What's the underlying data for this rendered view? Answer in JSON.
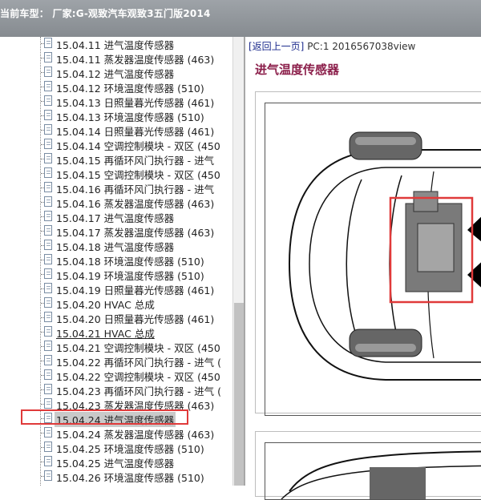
{
  "window": {
    "title": "当前车型：  厂家:G-观致汽车观致3五门版2014"
  },
  "tree": {
    "items": [
      {
        "label": "15.04.11 进气温度传感器"
      },
      {
        "label": "15.04.11 蒸发器温度传感器 (463)"
      },
      {
        "label": "15.04.12 进气温度传感器"
      },
      {
        "label": "15.04.12 环境温度传感器 (510)"
      },
      {
        "label": "15.04.13 日照量暮光传感器 (461)"
      },
      {
        "label": "15.04.13 环境温度传感器 (510)"
      },
      {
        "label": "15.04.14 日照量暮光传感器 (461)"
      },
      {
        "label": "15.04.14 空调控制模块 - 双区 (450"
      },
      {
        "label": "15.04.15 再循环风门执行器 - 进气"
      },
      {
        "label": "15.04.15 空调控制模块 - 双区 (450"
      },
      {
        "label": "15.04.16 再循环风门执行器 - 进气"
      },
      {
        "label": "15.04.16 蒸发器温度传感器 (463)"
      },
      {
        "label": "15.04.17 进气温度传感器"
      },
      {
        "label": "15.04.17 蒸发器温度传感器 (463)"
      },
      {
        "label": "15.04.18 进气温度传感器"
      },
      {
        "label": "15.04.18 环境温度传感器 (510)"
      },
      {
        "label": "15.04.19 环境温度传感器 (510)"
      },
      {
        "label": "15.04.19 日照量暮光传感器 (461)"
      },
      {
        "label": "15.04.20 HVAC 总成"
      },
      {
        "label": "15.04.20 日照量暮光传感器 (461)"
      },
      {
        "label": "15.04.21 HVAC 总成"
      },
      {
        "label": "15.04.21 空调控制模块 - 双区 (450"
      },
      {
        "label": "15.04.22 再循环风门执行器 - 进气 ("
      },
      {
        "label": "15.04.22 空调控制模块 - 双区 (450"
      },
      {
        "label": "15.04.23 再循环风门执行器 - 进气 ("
      },
      {
        "label": "15.04.23 蒸发器温度传感器 (463)"
      },
      {
        "label": "15.04.24 进气温度传感器"
      },
      {
        "label": "15.04.24 蒸发器温度传感器 (463)"
      },
      {
        "label": "15.04.25 环境温度传感器 (510)"
      },
      {
        "label": "15.04.25 进气温度传感器"
      },
      {
        "label": "15.04.26 环境温度传感器 (510)"
      }
    ]
  },
  "content": {
    "back_link": "[返回上一页]",
    "page_info": " PC:1 2016567038view",
    "heading": "进气温度传感器"
  },
  "colors": {
    "highlight_box": "#e03a3a",
    "heading": "#8b1e4a",
    "link": "#1b2a8c"
  }
}
